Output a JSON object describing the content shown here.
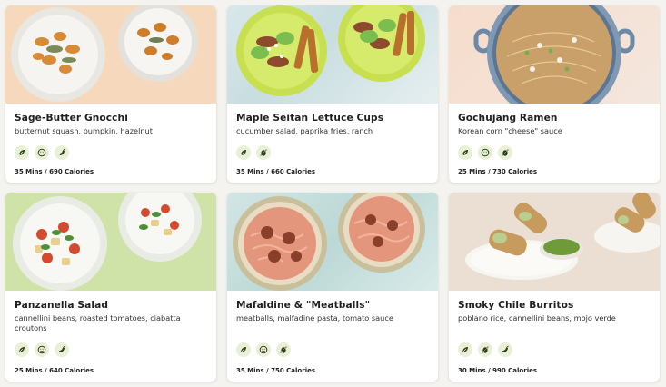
{
  "colors": {
    "tag_bg": "#e8f1d6",
    "tag_icon": "#2d3b1f"
  },
  "cards": [
    {
      "title": "Sage-Butter Gnocchi",
      "subtitle": "butternut squash, pumpkin, hazelnut",
      "tags": [
        "leaf-icon",
        "smile-icon",
        "pepper-icon"
      ],
      "meta": "35 Mins / 690 Calories",
      "image": "gnocchi-bowls"
    },
    {
      "title": "Maple Seitan Lettuce Cups",
      "subtitle": "cucumber salad, paprika fries, ranch",
      "tags": [
        "leaf-icon",
        "no-nut-icon"
      ],
      "meta": "35 Mins / 660 Calories",
      "image": "lettuce-cups-plates"
    },
    {
      "title": "Gochujang Ramen",
      "subtitle": "Korean corn \"cheese\" sauce",
      "tags": [
        "leaf-icon",
        "smile-icon",
        "no-nut-icon"
      ],
      "meta": "25 Mins / 730 Calories",
      "image": "ramen-pot"
    },
    {
      "title": "Panzanella Salad",
      "subtitle": "cannellini beans, roasted tomatoes, ciabatta croutons",
      "tags": [
        "leaf-icon",
        "smile-icon",
        "pepper-icon"
      ],
      "meta": "25 Mins / 640 Calories",
      "image": "panzanella-plates"
    },
    {
      "title": "Mafaldine & \"Meatballs\"",
      "subtitle": "meatballs, malfadine pasta, tomato sauce",
      "tags": [
        "leaf-icon",
        "smile-icon",
        "no-nut-icon"
      ],
      "meta": "35 Mins / 750 Calories",
      "image": "pasta-bowls"
    },
    {
      "title": "Smoky Chile Burritos",
      "subtitle": "poblano rice, cannellini beans, mojo verde",
      "tags": [
        "leaf-icon",
        "no-nut-icon",
        "pepper-icon"
      ],
      "meta": "30 Mins / 990 Calories",
      "image": "burritos-plates"
    }
  ]
}
